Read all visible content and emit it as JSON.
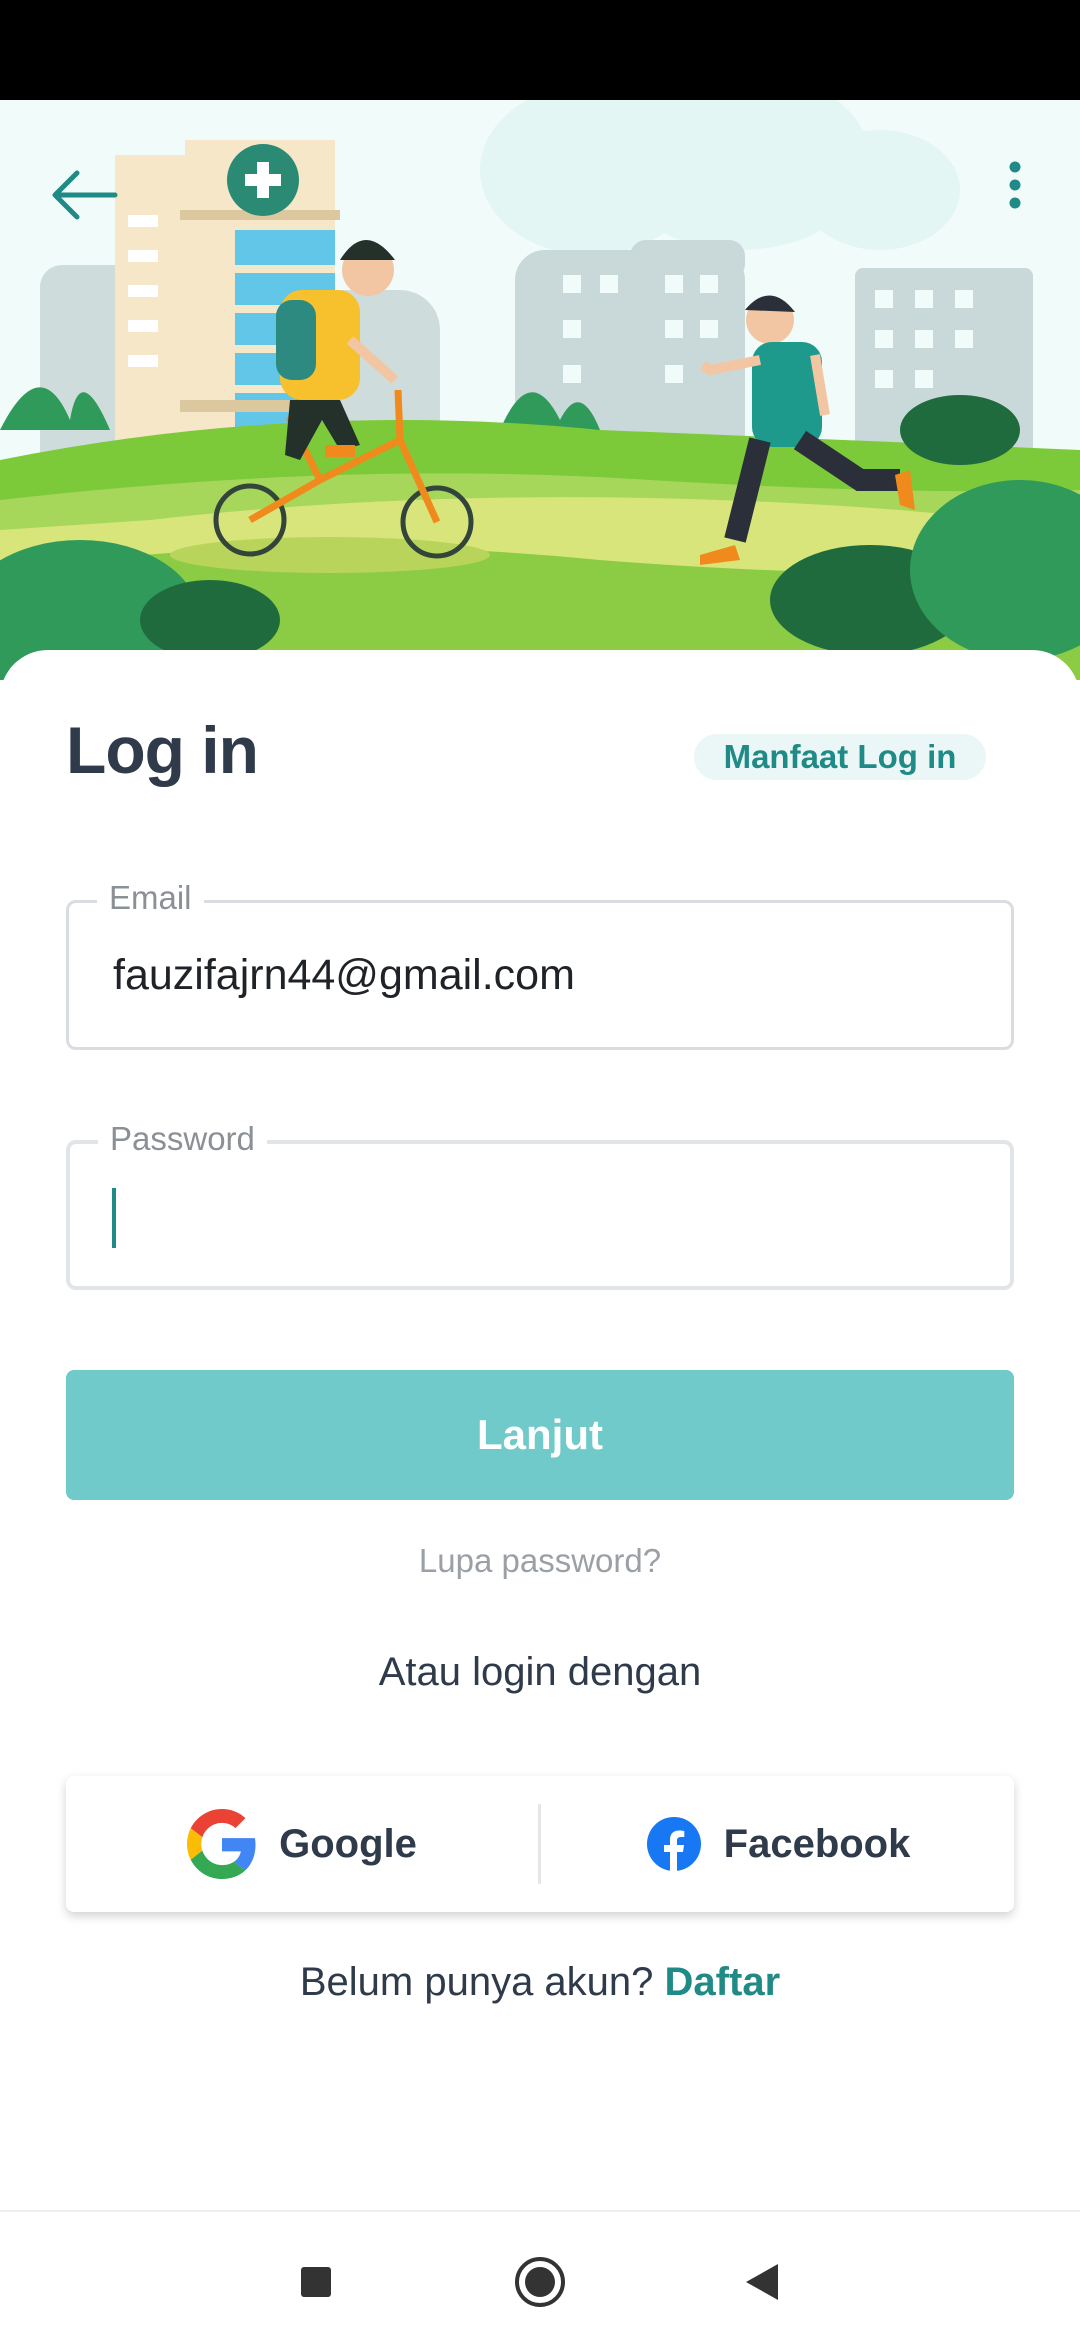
{
  "header": {
    "back_icon": "arrow-left-icon",
    "menu_icon": "more-vertical-icon",
    "illustration": "cyclist-and-runner-park-illustration"
  },
  "login": {
    "title": "Log in",
    "benefits_link": "Manfaat Log in",
    "email": {
      "label": "Email",
      "value": "fauzifajrn44@gmail.com"
    },
    "password": {
      "label": "Password",
      "value": ""
    },
    "submit_label": "Lanjut",
    "forgot_password": "Lupa password?",
    "alt_login_text": "Atau login dengan",
    "social": {
      "google": {
        "label": "Google",
        "icon": "google-icon"
      },
      "facebook": {
        "label": "Facebook",
        "icon": "facebook-icon"
      }
    },
    "signup_prompt": "Belum punya akun?",
    "signup_link": "Daftar"
  },
  "nav": {
    "recent_icon": "square-icon",
    "home_icon": "circle-icon",
    "back_icon": "triangle-back-icon"
  },
  "colors": {
    "accent": "#1f8a86",
    "button": "#71caca",
    "text": "#2f3a4a",
    "hero_bg": "#f1fbfa",
    "grass": "#7cc93a"
  }
}
